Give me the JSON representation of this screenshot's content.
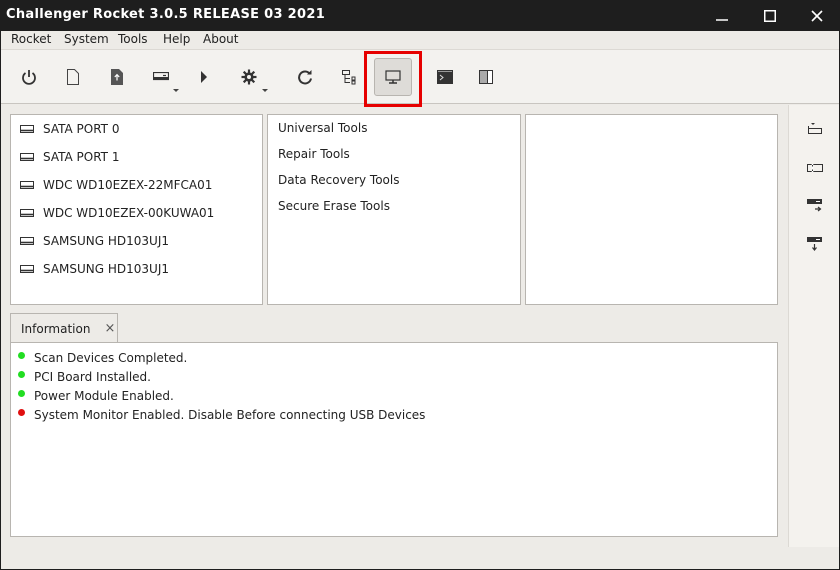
{
  "window": {
    "title": "Challenger Rocket 3.0.5 RELEASE 03 2021",
    "controls": [
      "minimize",
      "maximize",
      "close"
    ]
  },
  "menubar": {
    "items": [
      {
        "label": "Rocket"
      },
      {
        "label": "System"
      },
      {
        "label": "Tools"
      },
      {
        "label": "Help"
      },
      {
        "label": "About"
      }
    ]
  },
  "toolbar": {
    "buttons": [
      {
        "icon": "power-icon",
        "has_dropdown": false,
        "active": false
      },
      {
        "icon": "new-file-icon",
        "has_dropdown": false,
        "active": false
      },
      {
        "icon": "upload-file-icon",
        "has_dropdown": false,
        "active": false
      },
      {
        "icon": "drive-icon",
        "has_dropdown": true,
        "active": false
      },
      {
        "icon": "play-icon",
        "has_dropdown": false,
        "active": false
      },
      {
        "icon": "gear-icon",
        "has_dropdown": true,
        "active": false
      },
      {
        "icon": "refresh-icon",
        "has_dropdown": false,
        "active": false
      },
      {
        "icon": "tree-icon",
        "has_dropdown": false,
        "active": false
      },
      {
        "icon": "monitor-icon",
        "has_dropdown": false,
        "active": true,
        "highlighted": true
      },
      {
        "icon": "terminal-icon",
        "has_dropdown": false,
        "active": false
      },
      {
        "icon": "split-view-icon",
        "has_dropdown": false,
        "active": false
      }
    ],
    "highlight_color": "#e60000"
  },
  "devices": {
    "items": [
      {
        "label": "SATA PORT 0"
      },
      {
        "label": "SATA PORT 1"
      },
      {
        "label": "WDC WD10EZEX-22MFCA01"
      },
      {
        "label": "WDC WD10EZEX-00KUWA01"
      },
      {
        "label": "SAMSUNG HD103UJ1"
      },
      {
        "label": "SAMSUNG HD103UJ1"
      }
    ]
  },
  "tools": {
    "items": [
      {
        "label": "Universal Tools"
      },
      {
        "label": "Repair Tools"
      },
      {
        "label": "Data Recovery Tools"
      },
      {
        "label": "Secure Erase Tools"
      }
    ]
  },
  "right_sidebar": {
    "buttons": [
      {
        "icon": "eject-drive-icon"
      },
      {
        "icon": "drive-dashed-icon"
      },
      {
        "icon": "drive-arrow-right-icon"
      },
      {
        "icon": "drive-arrow-down-icon"
      }
    ]
  },
  "info_tab": {
    "label": "Information",
    "close_glyph": "×"
  },
  "info_log": {
    "items": [
      {
        "text": "Scan Devices Completed.",
        "status": "ok",
        "color": "#22dd22"
      },
      {
        "text": "PCI Board Installed.",
        "status": "ok",
        "color": "#22dd22"
      },
      {
        "text": "Power Module Enabled.",
        "status": "ok",
        "color": "#22dd22"
      },
      {
        "text": "System Monitor Enabled. Disable Before connecting USB Devices",
        "status": "warning",
        "color": "#e01010"
      }
    ]
  }
}
